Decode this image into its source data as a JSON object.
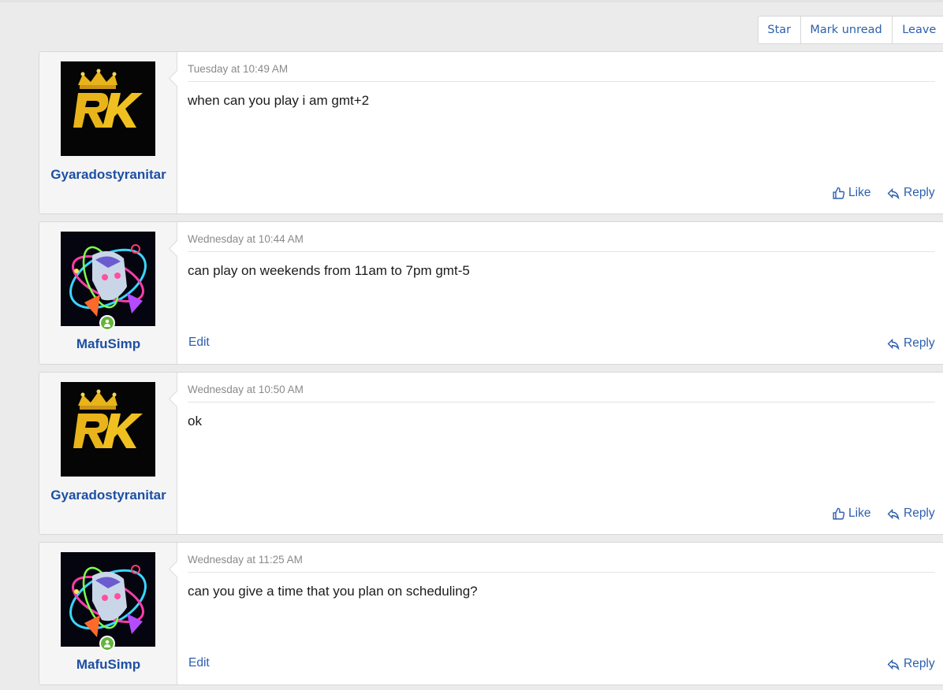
{
  "thread_actions": {
    "star": "Star",
    "mark_unread": "Mark unread",
    "leave": "Leave"
  },
  "messages": [
    {
      "user": "Gyaradostyranitar",
      "avatar": "rk-crown-logo",
      "online": false,
      "time": "Tuesday at 10:49 AM",
      "text": "when can you play i am gmt+2",
      "actions": {
        "like": "Like",
        "reply": "Reply"
      }
    },
    {
      "user": "MafuSimp",
      "avatar": "anime-neon-art",
      "online": true,
      "time": "Wednesday at 10:44 AM",
      "text": "can play on weekends from 11am to 7pm gmt-5",
      "actions": {
        "edit": "Edit",
        "reply": "Reply"
      }
    },
    {
      "user": "Gyaradostyranitar",
      "avatar": "rk-crown-logo",
      "online": false,
      "time": "Wednesday at 10:50 AM",
      "text": "ok",
      "actions": {
        "like": "Like",
        "reply": "Reply"
      }
    },
    {
      "user": "MafuSimp",
      "avatar": "anime-neon-art",
      "online": true,
      "time": "Wednesday at 11:25 AM",
      "text": "can you give a time that you plan on scheduling?",
      "actions": {
        "edit": "Edit",
        "reply": "Reply"
      }
    }
  ],
  "colors": {
    "link": "#2c5fae",
    "username": "#1d4fa3",
    "online": "#65b53b",
    "timestamp": "#8a8a8a"
  }
}
